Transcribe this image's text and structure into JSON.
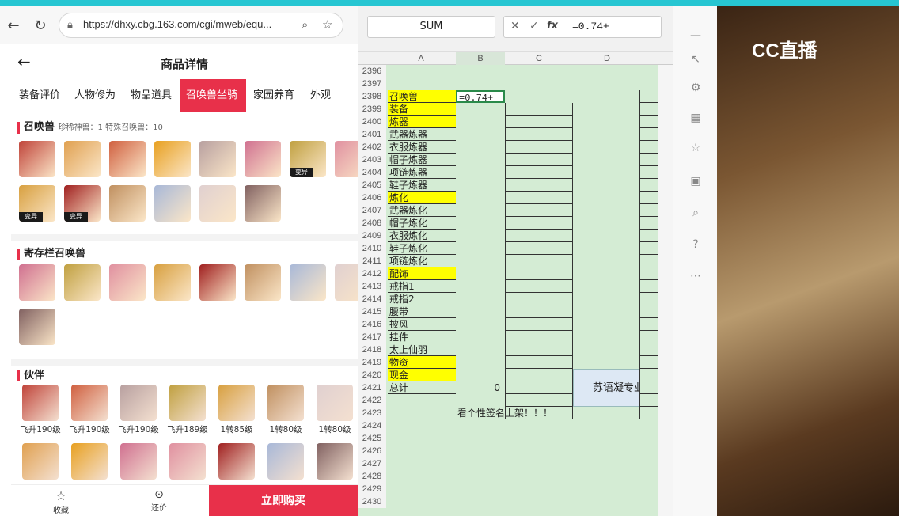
{
  "browser": {
    "url": "https://dhxy.cbg.163.com/cgi/mweb/equ...",
    "page_title": "商品详情",
    "tabs": [
      "装备评价",
      "人物修为",
      "物品道具",
      "召唤兽坐骑",
      "家园养育",
      "外观"
    ],
    "section1": {
      "title": "召唤兽",
      "sub": "珍稀神兽：1  特殊召唤兽：10"
    },
    "pet_badge": "变异",
    "section2": {
      "title": "寄存栏召唤兽"
    },
    "section3": {
      "title": "伙伴"
    },
    "partners": [
      "飞升190级",
      "飞升190级",
      "飞升190级",
      "飞升189级",
      "1转85级",
      "1转80级",
      "1转80级"
    ],
    "bottom": {
      "fav": "收藏",
      "bargain": "还价",
      "buy": "立即购买"
    }
  },
  "sheet": {
    "namebox": "SUM",
    "formula": "=0.74+",
    "cols": [
      "A",
      "B",
      "C",
      "D"
    ],
    "rows": [
      {
        "n": "2396",
        "a": ""
      },
      {
        "n": "2397",
        "a": ""
      },
      {
        "n": "2398",
        "a": "召唤兽",
        "hl": true,
        "b": "=0.74+"
      },
      {
        "n": "2399",
        "a": "装备",
        "hl": true
      },
      {
        "n": "2400",
        "a": "炼器",
        "hl": true
      },
      {
        "n": "2401",
        "a": "武器炼器"
      },
      {
        "n": "2402",
        "a": "衣服炼器"
      },
      {
        "n": "2403",
        "a": "帽子炼器"
      },
      {
        "n": "2404",
        "a": "项链炼器"
      },
      {
        "n": "2405",
        "a": "鞋子炼器"
      },
      {
        "n": "2406",
        "a": "炼化",
        "hl": true
      },
      {
        "n": "2407",
        "a": "武器炼化"
      },
      {
        "n": "2408",
        "a": "帽子炼化"
      },
      {
        "n": "2409",
        "a": "衣服炼化"
      },
      {
        "n": "2410",
        "a": "鞋子炼化"
      },
      {
        "n": "2411",
        "a": "项链炼化"
      },
      {
        "n": "2412",
        "a": "配饰",
        "hl": true
      },
      {
        "n": "2413",
        "a": "戒指1"
      },
      {
        "n": "2414",
        "a": "戒指2"
      },
      {
        "n": "2415",
        "a": "腰带"
      },
      {
        "n": "2416",
        "a": "披风"
      },
      {
        "n": "2417",
        "a": "挂件"
      },
      {
        "n": "2418",
        "a": "太上仙羽"
      },
      {
        "n": "2419",
        "a": "物资",
        "hl": true
      },
      {
        "n": "2420",
        "a": "现金",
        "hl": true
      },
      {
        "n": "2421",
        "a": "总计",
        "b": "0"
      },
      {
        "n": "2422",
        "a": ""
      },
      {
        "n": "2423",
        "a": "",
        "b": "看个性签名上架！！！"
      },
      {
        "n": "2424",
        "a": ""
      },
      {
        "n": "2425",
        "a": ""
      },
      {
        "n": "2426",
        "a": ""
      },
      {
        "n": "2427",
        "a": ""
      },
      {
        "n": "2428",
        "a": ""
      },
      {
        "n": "2429",
        "a": ""
      },
      {
        "n": "2430",
        "a": ""
      }
    ],
    "d_note": "苏语凝专业评"
  },
  "video": {
    "logo": "CC直播"
  },
  "colors": {
    "accent": "#e8304a",
    "highlight": "#ffff00",
    "grid": "#d4ecd4"
  }
}
